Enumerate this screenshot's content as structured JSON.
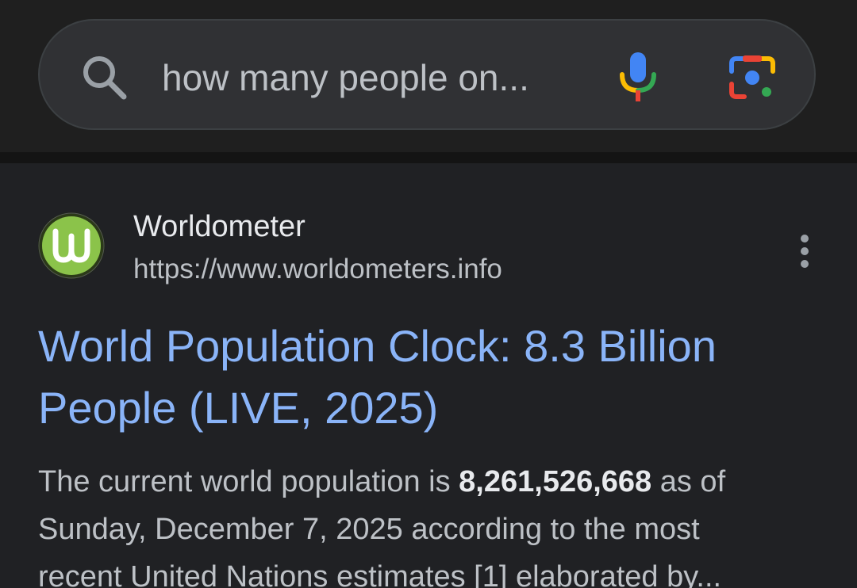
{
  "search": {
    "query": "how many people on...",
    "icons": {
      "search": "search-icon",
      "voice": "microphone-icon",
      "lens": "camera-lens-icon"
    }
  },
  "result": {
    "site_name": "Worldometer",
    "site_url": "https://www.worldometers.info",
    "favicon_letter": "W",
    "title_line1": "World Population Clock: 8.3 Billion",
    "title_line2": "People (LIVE, 2025)",
    "snippet": {
      "before": "The current world population is ",
      "bold": "8,261,526,668",
      "after_line1": " as of",
      "line2": "Sunday, December 7, 2025 according to the most",
      "line3": "recent United Nations estimates [1] elaborated by..."
    }
  },
  "colors": {
    "background": "#202124",
    "search_bar": "#303134",
    "link": "#8ab4f8",
    "text": "#bdc1c6"
  }
}
